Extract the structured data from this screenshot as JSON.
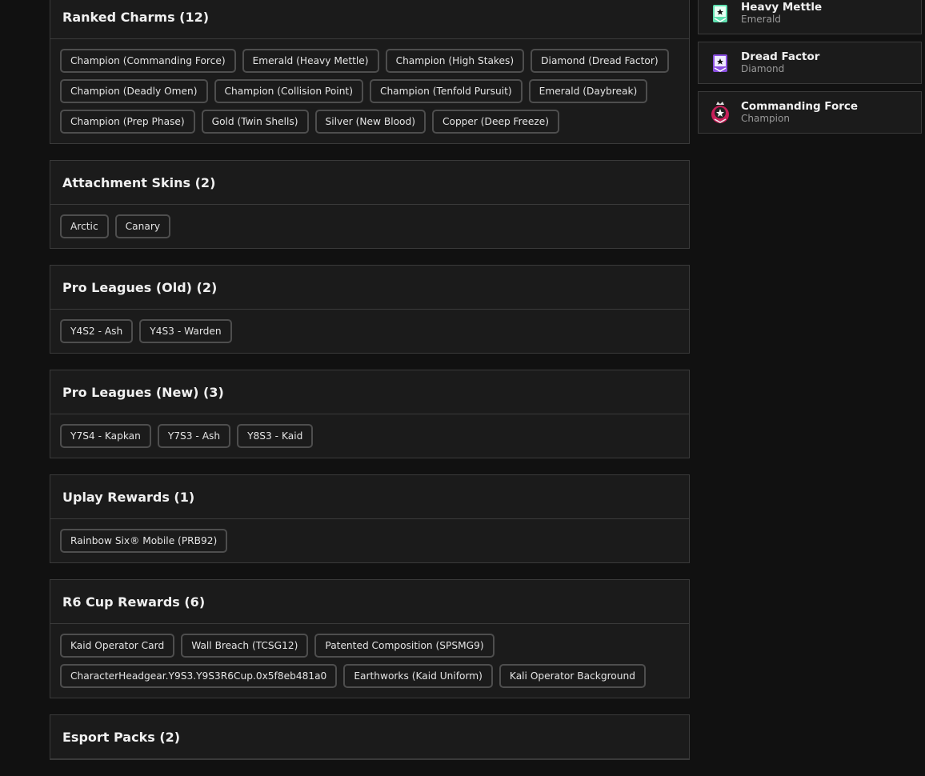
{
  "sections": [
    {
      "title": "Ranked Charms (12)",
      "items": [
        "Champion (Commanding Force)",
        "Emerald (Heavy Mettle)",
        "Champion (High Stakes)",
        "Diamond (Dread Factor)",
        "Champion (Deadly Omen)",
        "Champion (Collision Point)",
        "Champion (Tenfold Pursuit)",
        "Emerald (Daybreak)",
        "Champion (Prep Phase)",
        "Gold (Twin Shells)",
        "Silver (New Blood)",
        "Copper (Deep Freeze)"
      ]
    },
    {
      "title": "Attachment Skins (2)",
      "items": [
        "Arctic",
        "Canary"
      ]
    },
    {
      "title": "Pro Leagues (Old) (2)",
      "items": [
        "Y4S2 - Ash",
        "Y4S3 - Warden"
      ]
    },
    {
      "title": "Pro Leagues (New) (3)",
      "items": [
        "Y7S4 - Kapkan",
        "Y7S3 - Ash",
        "Y8S3 - Kaid"
      ]
    },
    {
      "title": "Uplay Rewards (1)",
      "items": [
        "Rainbow Six® Mobile (PRB92)"
      ]
    },
    {
      "title": "R6 Cup Rewards (6)",
      "items": [
        "Kaid Operator Card",
        "Wall Breach (TCSG12)",
        "Patented Composition (SPSMG9)",
        "CharacterHeadgear.Y9S3.Y9S3R6Cup.0x5f8eb481a0",
        "Earthworks (Kaid Uniform)",
        "Kali Operator Background"
      ]
    },
    {
      "title": "Esport Packs (2)",
      "items": []
    }
  ],
  "sidebar": [
    {
      "name": "Heavy Mettle",
      "rank": "Emerald",
      "color": "#5fe0b0",
      "icon": "emerald-charm-icon"
    },
    {
      "name": "Dread Factor",
      "rank": "Diamond",
      "color": "#8a4fe0",
      "icon": "diamond-charm-icon"
    },
    {
      "name": "Commanding Force",
      "rank": "Champion",
      "color": "#c8205a",
      "icon": "champion-charm-icon"
    }
  ]
}
